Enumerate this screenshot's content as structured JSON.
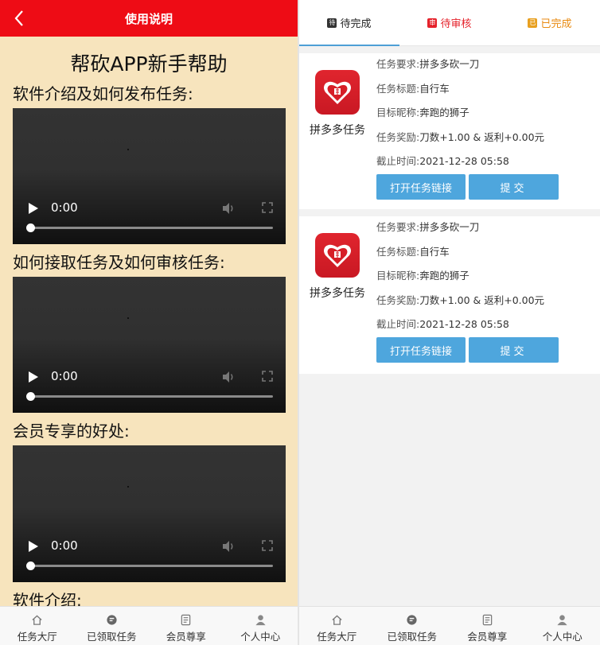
{
  "left": {
    "header_title": "使用说明",
    "help_title": "帮砍APP新手帮助",
    "sections": [
      {
        "title": "软件介绍及如何发布任务:",
        "time": "0:00"
      },
      {
        "title": "如何接取任务及如何审核任务:",
        "time": "0:00"
      },
      {
        "title": "会员专享的好处:",
        "time": "0:00"
      }
    ],
    "cut_title": "软件介绍:"
  },
  "tabbar": [
    {
      "label": "任务大厅",
      "icon": "home-icon"
    },
    {
      "label": "已领取任务",
      "icon": "task-icon"
    },
    {
      "label": "会员尊享",
      "icon": "vip-icon"
    },
    {
      "label": "个人中心",
      "icon": "user-icon"
    }
  ],
  "right": {
    "tabs": [
      {
        "badge": "待",
        "label": "待完成",
        "color": "#222222",
        "badge_color": "#333333"
      },
      {
        "badge": "审",
        "label": "待审核",
        "color": "#e5222b",
        "badge_color": "#e5222b"
      },
      {
        "badge": "已",
        "label": "已完成",
        "color": "#e88a10",
        "badge_color": "#e8a020"
      }
    ],
    "cards": [
      {
        "app_name": "拼多多任务",
        "req_key": "任务要求:",
        "req_val": "拼多多砍一刀",
        "title_key": "任务标题:",
        "title_val": "自行车",
        "nick_key": "目标昵称:",
        "nick_val": "奔跑的狮子",
        "reward_key": "任务奖励:",
        "reward_val": "刀数+1.00 & 返利+0.00元",
        "deadline_key": "截止时间:",
        "deadline_val": "2021-12-28 05:58",
        "open_label": "打开任务链接",
        "submit_label": "提交"
      },
      {
        "app_name": "拼多多任务",
        "req_key": "任务要求:",
        "req_val": "拼多多砍一刀",
        "title_key": "任务标题:",
        "title_val": "自行车",
        "nick_key": "目标昵称:",
        "nick_val": "奔跑的狮子",
        "reward_key": "任务奖励:",
        "reward_val": "刀数+1.00 & 返利+0.00元",
        "deadline_key": "截止时间:",
        "deadline_val": "2021-12-28 05:58",
        "open_label": "打开任务链接",
        "submit_label": "提交"
      }
    ]
  },
  "colors": {
    "header_red": "#ee0c15",
    "page_bg": "#f7e4bd",
    "button_blue": "#4ea6dd"
  }
}
